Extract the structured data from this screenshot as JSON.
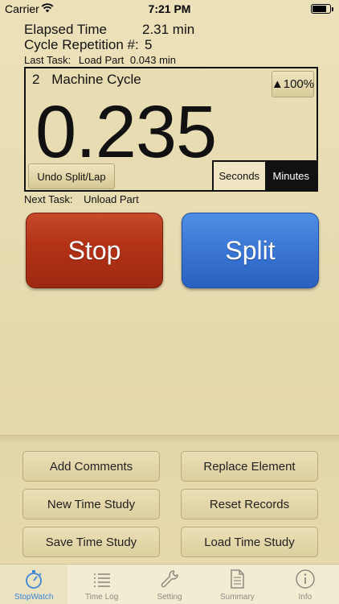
{
  "status_bar": {
    "carrier": "Carrier",
    "time": "7:21 PM"
  },
  "info": {
    "elapsed_label": "Elapsed Time",
    "elapsed_value": "2.31 min",
    "cycle_label": "Cycle Repetition #:",
    "cycle_value": "5",
    "last_task_label": "Last Task:",
    "last_task_value": "Load Part",
    "last_task_time": "0.043 min"
  },
  "timer": {
    "task_number": "2",
    "task_name": "Machine Cycle",
    "percent_label": "▲100%",
    "display": "0.235",
    "undo_label": "Undo Split/Lap",
    "unit_seconds": "Seconds",
    "unit_minutes": "Minutes",
    "selected_unit": "Minutes"
  },
  "next_task": {
    "label": "Next Task:",
    "value": "Unload Part"
  },
  "main_buttons": {
    "stop": "Stop",
    "split": "Split",
    "stop_color": "#b43317",
    "split_color": "#3c78d6"
  },
  "actions": {
    "add_comments": "Add Comments",
    "replace_element": "Replace Element",
    "new_time_study": "New Time Study",
    "reset_records": "Reset Records",
    "save_time_study": "Save Time Study",
    "load_time_study": "Load Time Study"
  },
  "tabs": [
    {
      "label": "StopWatch",
      "icon": "stopwatch-icon",
      "active": true
    },
    {
      "label": "Time Log",
      "icon": "list-icon",
      "active": false
    },
    {
      "label": "Setting",
      "icon": "wrench-icon",
      "active": false
    },
    {
      "label": "Summary",
      "icon": "document-icon",
      "active": false
    },
    {
      "label": "Info",
      "icon": "info-icon",
      "active": false
    }
  ],
  "colors": {
    "background": "#e8dcb2",
    "active_tab": "#3a86d8"
  }
}
